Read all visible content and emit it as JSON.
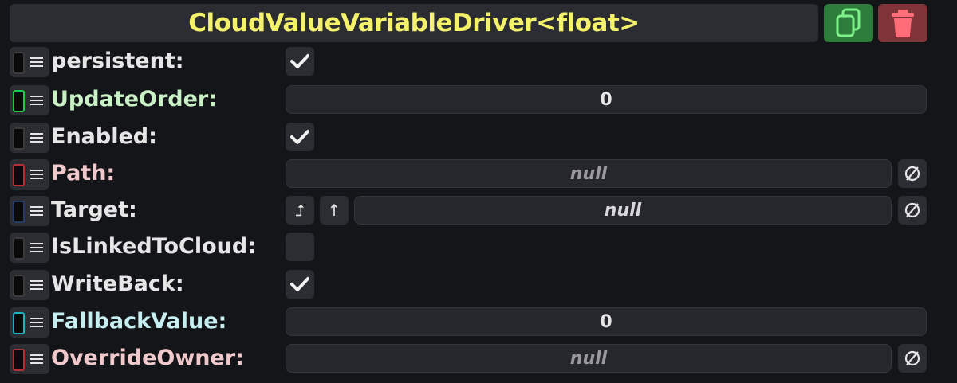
{
  "header": {
    "title": "CloudValueVariableDriver<float>",
    "copy_icon": "copy-icon",
    "delete_icon": "trash-icon"
  },
  "colors": {
    "title": "#f4f26a",
    "panel": "#2b2d33",
    "copy_bg": "#2d7d3a",
    "delete_bg": "#7f3438"
  },
  "rows": [
    {
      "label": "persistent:",
      "label_color": "#e6e6e6",
      "swatch": "#3a3a3a",
      "control": "checkbox",
      "checked": true
    },
    {
      "label": "UpdateOrder:",
      "label_color": "#c9f1c5",
      "swatch": "#1fc94a",
      "control": "field",
      "value": "0"
    },
    {
      "label": "Enabled:",
      "label_color": "#e6e6e6",
      "swatch": "#3a3a3a",
      "control": "checkbox",
      "checked": true
    },
    {
      "label": "Path:",
      "label_color": "#f0c9cc",
      "swatch": "#b52f36",
      "control": "ref",
      "value": "null"
    },
    {
      "label": "Target:",
      "label_color": "#e6e6e6",
      "swatch": "#263a6a",
      "control": "target",
      "value": "null",
      "btn1": "⮥",
      "btn2": "↑"
    },
    {
      "label": "IsLinkedToCloud:",
      "label_color": "#e6e6e6",
      "swatch": "#3a3a3a",
      "control": "checkbox",
      "checked": false
    },
    {
      "label": "WriteBack:",
      "label_color": "#e6e6e6",
      "swatch": "#3a3a3a",
      "control": "checkbox",
      "checked": true
    },
    {
      "label": "FallbackValue:",
      "label_color": "#c6eef0",
      "swatch": "#1fb3c0",
      "control": "field",
      "value": "0"
    },
    {
      "label": "OverrideOwner:",
      "label_color": "#f0c9cc",
      "swatch": "#b52f36",
      "control": "ref",
      "value": "null"
    }
  ]
}
